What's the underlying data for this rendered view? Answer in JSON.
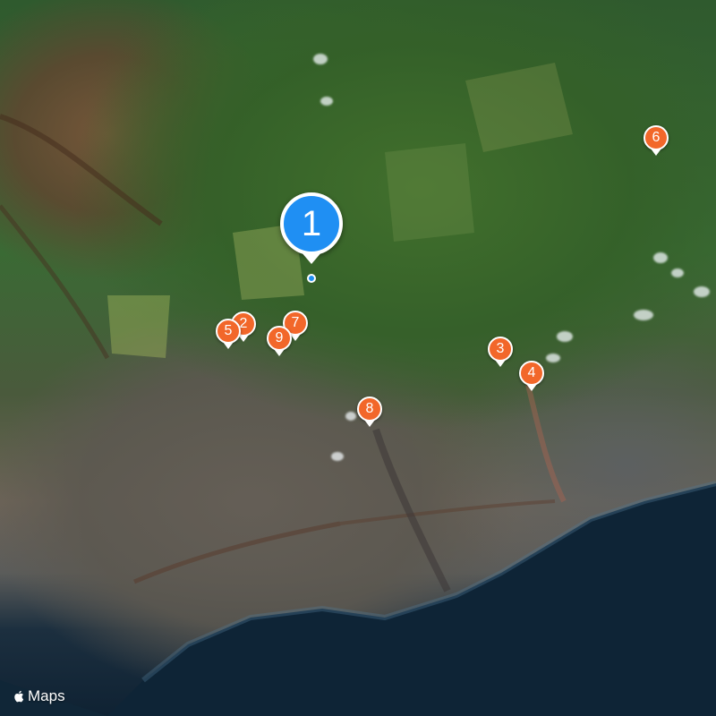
{
  "map": {
    "style": "satellite",
    "attribution": "Maps",
    "attribution_icon": "apple-logo-icon",
    "primary_marker": {
      "label": "1",
      "color": "#1f8ff3"
    },
    "markers": [
      {
        "label": "2",
        "color": "#f2672a"
      },
      {
        "label": "3",
        "color": "#f2672a"
      },
      {
        "label": "4",
        "color": "#f2672a"
      },
      {
        "label": "5",
        "color": "#f2672a"
      },
      {
        "label": "6",
        "color": "#f2672a"
      },
      {
        "label": "7",
        "color": "#f2672a"
      },
      {
        "label": "8",
        "color": "#f2672a"
      },
      {
        "label": "9",
        "color": "#f2672a"
      }
    ]
  }
}
